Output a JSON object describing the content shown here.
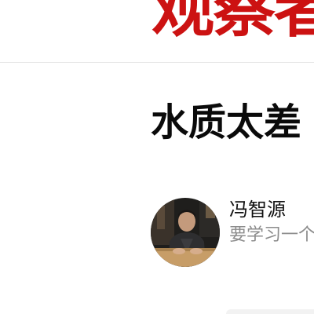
{
  "header": {
    "site_logo_text": "观察者"
  },
  "article": {
    "title": "水质太差"
  },
  "author": {
    "name": "冯智源",
    "description": "要学习一个"
  },
  "colors": {
    "brand_red": "#cc1212",
    "title_text": "#0a0a0a",
    "muted_text": "#8c8c8c",
    "divider": "#e6e6e6"
  }
}
